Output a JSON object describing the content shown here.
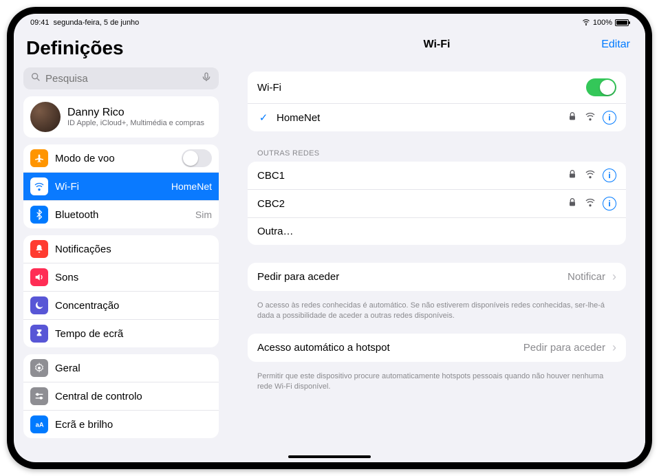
{
  "statusbar": {
    "time": "09:41",
    "date": "segunda-feira, 5 de junho",
    "battery": "100%"
  },
  "sidebar": {
    "title": "Definições",
    "search_placeholder": "Pesquisa",
    "account": {
      "name": "Danny Rico",
      "sub": "ID Apple, iCloud+, Multimédia e compras"
    },
    "g1": {
      "airplane": "Modo de voo",
      "wifi": "Wi-Fi",
      "wifi_value": "HomeNet",
      "bluetooth": "Bluetooth",
      "bluetooth_value": "Sim"
    },
    "g2": {
      "notifications": "Notificações",
      "sounds": "Sons",
      "focus": "Concentração",
      "screentime": "Tempo de ecrã"
    },
    "g3": {
      "general": "Geral",
      "control": "Central de controlo",
      "display": "Ecrã e brilho"
    }
  },
  "detail": {
    "title": "Wi-Fi",
    "edit": "Editar",
    "wifi_row": "Wi-Fi",
    "connected": "HomeNet",
    "other_header": "Outras redes",
    "net1": "CBC1",
    "net2": "CBC2",
    "other": "Outra…",
    "ask": {
      "label": "Pedir para aceder",
      "value": "Notificar",
      "note": "O acesso às redes conhecidas é automático. Se não estiverem disponíveis redes conhecidas, ser-lhe-á dada a possibilidade de aceder a outras redes disponíveis."
    },
    "hotspot": {
      "label": "Acesso automático a hotspot",
      "value": "Pedir para aceder",
      "note": "Permitir que este dispositivo procure automaticamente hotspots pessoais quando não houver nenhuma rede Wi-Fi disponível."
    }
  }
}
